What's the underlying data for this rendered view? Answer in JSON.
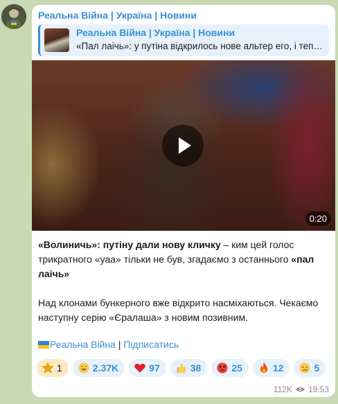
{
  "channel": {
    "name": "Реальна Війна | Україна | Новини"
  },
  "reply": {
    "title": "Реальна Війна | Україна | Новини",
    "text": "«Пал лаічь»: у путіна відкрилось нове альтер его, і тепер..."
  },
  "video": {
    "duration": "0:20"
  },
  "message": {
    "p1_bold_a": "«Волиничь»: путіну дали нову кличку",
    "p1_plain": " – ким цей голос трикратного «уаа» тільки не був, згадаємо з останнього ",
    "p1_bold_b": "«пал лаічь»",
    "p2": "Над клонами бункерного вже відкрито насміхаються. Чекаємо наступну серію «Єралаша» з новим позивним."
  },
  "footer": {
    "link1": "Реальна Війна",
    "separator": " | ",
    "link2": "Підписатись"
  },
  "reactions": [
    {
      "icon": "star-icon",
      "count": "1"
    },
    {
      "icon": "grin-emoji-icon",
      "count": "2.37K"
    },
    {
      "icon": "heart-icon",
      "count": "97"
    },
    {
      "icon": "thumbs-up-icon",
      "count": "38"
    },
    {
      "icon": "angry-emoji-icon",
      "count": "25"
    },
    {
      "icon": "fire-icon",
      "count": "12"
    },
    {
      "icon": "sad-emoji-icon",
      "count": "5"
    }
  ],
  "meta": {
    "views": "112K",
    "time": "19:53"
  },
  "colors": {
    "accent": "#3a8fd0",
    "background": "#c9d9b4",
    "bubble": "#ffffff"
  }
}
